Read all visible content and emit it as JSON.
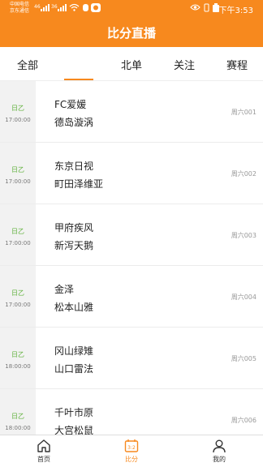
{
  "status_bar": {
    "carrier_line1": "中国电信",
    "carrier_line2": "京东通信",
    "signal1": "46",
    "signal2": "36",
    "time": "下午3:53"
  },
  "header": {
    "title": "比分直播"
  },
  "tabs": [
    {
      "label": "全部"
    },
    {
      "label": "北单"
    },
    {
      "label": "关注"
    },
    {
      "label": "赛程"
    }
  ],
  "matches": [
    {
      "league": "日乙",
      "time": "17:00:00",
      "home": "FC爱媛",
      "away": "德岛漩涡",
      "match_no": "周六001"
    },
    {
      "league": "日乙",
      "time": "17:00:00",
      "home": "东京日视",
      "away": "町田泽维亚",
      "match_no": "周六002"
    },
    {
      "league": "日乙",
      "time": "17:00:00",
      "home": "甲府疾风",
      "away": "新泻天鹅",
      "match_no": "周六003"
    },
    {
      "league": "日乙",
      "time": "17:00:00",
      "home": "金泽",
      "away": "松本山雅",
      "match_no": "周六004"
    },
    {
      "league": "日乙",
      "time": "18:00:00",
      "home": "冈山绿雉",
      "away": "山口雷法",
      "match_no": "周六005"
    },
    {
      "league": "日乙",
      "time": "18:00:00",
      "home": "千叶市原",
      "away": "大宫松鼠",
      "match_no": "周六006"
    }
  ],
  "bottom_nav": [
    {
      "label": "首页",
      "icon": "home-icon"
    },
    {
      "label": "比分",
      "icon": "scoreboard-icon"
    },
    {
      "label": "我的",
      "icon": "user-icon"
    }
  ],
  "colors": {
    "accent": "#f7891e",
    "league_green": "#5eb03a"
  }
}
